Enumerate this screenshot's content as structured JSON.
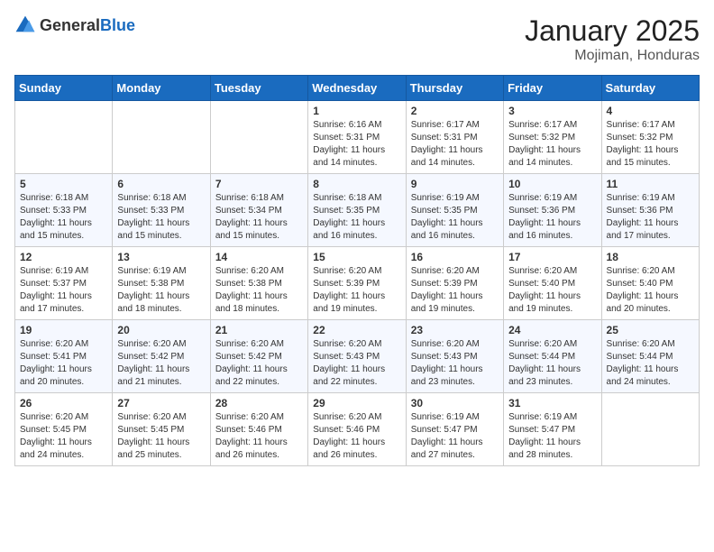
{
  "logo": {
    "general": "General",
    "blue": "Blue"
  },
  "header": {
    "month": "January 2025",
    "location": "Mojiman, Honduras"
  },
  "days_of_week": [
    "Sunday",
    "Monday",
    "Tuesday",
    "Wednesday",
    "Thursday",
    "Friday",
    "Saturday"
  ],
  "weeks": [
    [
      {
        "day": "",
        "sunrise": "",
        "sunset": "",
        "daylight": ""
      },
      {
        "day": "",
        "sunrise": "",
        "sunset": "",
        "daylight": ""
      },
      {
        "day": "",
        "sunrise": "",
        "sunset": "",
        "daylight": ""
      },
      {
        "day": "1",
        "sunrise": "Sunrise: 6:16 AM",
        "sunset": "Sunset: 5:31 PM",
        "daylight": "Daylight: 11 hours and 14 minutes."
      },
      {
        "day": "2",
        "sunrise": "Sunrise: 6:17 AM",
        "sunset": "Sunset: 5:31 PM",
        "daylight": "Daylight: 11 hours and 14 minutes."
      },
      {
        "day": "3",
        "sunrise": "Sunrise: 6:17 AM",
        "sunset": "Sunset: 5:32 PM",
        "daylight": "Daylight: 11 hours and 14 minutes."
      },
      {
        "day": "4",
        "sunrise": "Sunrise: 6:17 AM",
        "sunset": "Sunset: 5:32 PM",
        "daylight": "Daylight: 11 hours and 15 minutes."
      }
    ],
    [
      {
        "day": "5",
        "sunrise": "Sunrise: 6:18 AM",
        "sunset": "Sunset: 5:33 PM",
        "daylight": "Daylight: 11 hours and 15 minutes."
      },
      {
        "day": "6",
        "sunrise": "Sunrise: 6:18 AM",
        "sunset": "Sunset: 5:33 PM",
        "daylight": "Daylight: 11 hours and 15 minutes."
      },
      {
        "day": "7",
        "sunrise": "Sunrise: 6:18 AM",
        "sunset": "Sunset: 5:34 PM",
        "daylight": "Daylight: 11 hours and 15 minutes."
      },
      {
        "day": "8",
        "sunrise": "Sunrise: 6:18 AM",
        "sunset": "Sunset: 5:35 PM",
        "daylight": "Daylight: 11 hours and 16 minutes."
      },
      {
        "day": "9",
        "sunrise": "Sunrise: 6:19 AM",
        "sunset": "Sunset: 5:35 PM",
        "daylight": "Daylight: 11 hours and 16 minutes."
      },
      {
        "day": "10",
        "sunrise": "Sunrise: 6:19 AM",
        "sunset": "Sunset: 5:36 PM",
        "daylight": "Daylight: 11 hours and 16 minutes."
      },
      {
        "day": "11",
        "sunrise": "Sunrise: 6:19 AM",
        "sunset": "Sunset: 5:36 PM",
        "daylight": "Daylight: 11 hours and 17 minutes."
      }
    ],
    [
      {
        "day": "12",
        "sunrise": "Sunrise: 6:19 AM",
        "sunset": "Sunset: 5:37 PM",
        "daylight": "Daylight: 11 hours and 17 minutes."
      },
      {
        "day": "13",
        "sunrise": "Sunrise: 6:19 AM",
        "sunset": "Sunset: 5:38 PM",
        "daylight": "Daylight: 11 hours and 18 minutes."
      },
      {
        "day": "14",
        "sunrise": "Sunrise: 6:20 AM",
        "sunset": "Sunset: 5:38 PM",
        "daylight": "Daylight: 11 hours and 18 minutes."
      },
      {
        "day": "15",
        "sunrise": "Sunrise: 6:20 AM",
        "sunset": "Sunset: 5:39 PM",
        "daylight": "Daylight: 11 hours and 19 minutes."
      },
      {
        "day": "16",
        "sunrise": "Sunrise: 6:20 AM",
        "sunset": "Sunset: 5:39 PM",
        "daylight": "Daylight: 11 hours and 19 minutes."
      },
      {
        "day": "17",
        "sunrise": "Sunrise: 6:20 AM",
        "sunset": "Sunset: 5:40 PM",
        "daylight": "Daylight: 11 hours and 19 minutes."
      },
      {
        "day": "18",
        "sunrise": "Sunrise: 6:20 AM",
        "sunset": "Sunset: 5:40 PM",
        "daylight": "Daylight: 11 hours and 20 minutes."
      }
    ],
    [
      {
        "day": "19",
        "sunrise": "Sunrise: 6:20 AM",
        "sunset": "Sunset: 5:41 PM",
        "daylight": "Daylight: 11 hours and 20 minutes."
      },
      {
        "day": "20",
        "sunrise": "Sunrise: 6:20 AM",
        "sunset": "Sunset: 5:42 PM",
        "daylight": "Daylight: 11 hours and 21 minutes."
      },
      {
        "day": "21",
        "sunrise": "Sunrise: 6:20 AM",
        "sunset": "Sunset: 5:42 PM",
        "daylight": "Daylight: 11 hours and 22 minutes."
      },
      {
        "day": "22",
        "sunrise": "Sunrise: 6:20 AM",
        "sunset": "Sunset: 5:43 PM",
        "daylight": "Daylight: 11 hours and 22 minutes."
      },
      {
        "day": "23",
        "sunrise": "Sunrise: 6:20 AM",
        "sunset": "Sunset: 5:43 PM",
        "daylight": "Daylight: 11 hours and 23 minutes."
      },
      {
        "day": "24",
        "sunrise": "Sunrise: 6:20 AM",
        "sunset": "Sunset: 5:44 PM",
        "daylight": "Daylight: 11 hours and 23 minutes."
      },
      {
        "day": "25",
        "sunrise": "Sunrise: 6:20 AM",
        "sunset": "Sunset: 5:44 PM",
        "daylight": "Daylight: 11 hours and 24 minutes."
      }
    ],
    [
      {
        "day": "26",
        "sunrise": "Sunrise: 6:20 AM",
        "sunset": "Sunset: 5:45 PM",
        "daylight": "Daylight: 11 hours and 24 minutes."
      },
      {
        "day": "27",
        "sunrise": "Sunrise: 6:20 AM",
        "sunset": "Sunset: 5:45 PM",
        "daylight": "Daylight: 11 hours and 25 minutes."
      },
      {
        "day": "28",
        "sunrise": "Sunrise: 6:20 AM",
        "sunset": "Sunset: 5:46 PM",
        "daylight": "Daylight: 11 hours and 26 minutes."
      },
      {
        "day": "29",
        "sunrise": "Sunrise: 6:20 AM",
        "sunset": "Sunset: 5:46 PM",
        "daylight": "Daylight: 11 hours and 26 minutes."
      },
      {
        "day": "30",
        "sunrise": "Sunrise: 6:19 AM",
        "sunset": "Sunset: 5:47 PM",
        "daylight": "Daylight: 11 hours and 27 minutes."
      },
      {
        "day": "31",
        "sunrise": "Sunrise: 6:19 AM",
        "sunset": "Sunset: 5:47 PM",
        "daylight": "Daylight: 11 hours and 28 minutes."
      },
      {
        "day": "",
        "sunrise": "",
        "sunset": "",
        "daylight": ""
      }
    ]
  ]
}
